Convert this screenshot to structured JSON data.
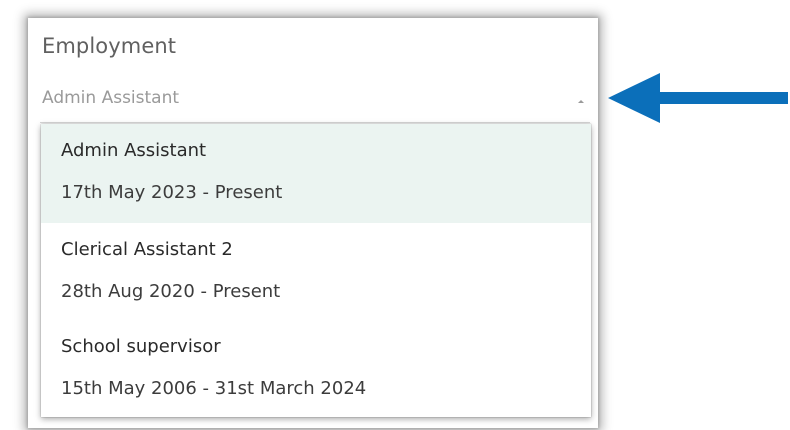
{
  "field": {
    "label": "Employment",
    "selected_value": "Admin Assistant",
    "caret_icon": "caret-up-icon"
  },
  "dropdown": {
    "options": [
      {
        "title": "Admin Assistant",
        "dates": "17th May 2023 - Present",
        "selected": true
      },
      {
        "title": "Clerical Assistant 2",
        "dates": "28th Aug 2020 - Present",
        "selected": false
      },
      {
        "title": "School supervisor",
        "dates": "15th May 2006 - 31st March 2024",
        "selected": false
      }
    ]
  },
  "annotation": {
    "icon": "arrow-left-icon",
    "color": "#0b6fba"
  },
  "colors": {
    "selected_option_bg": "#ebf4f1",
    "label_text": "#606060",
    "placeholder_text": "#9a9a9a"
  }
}
